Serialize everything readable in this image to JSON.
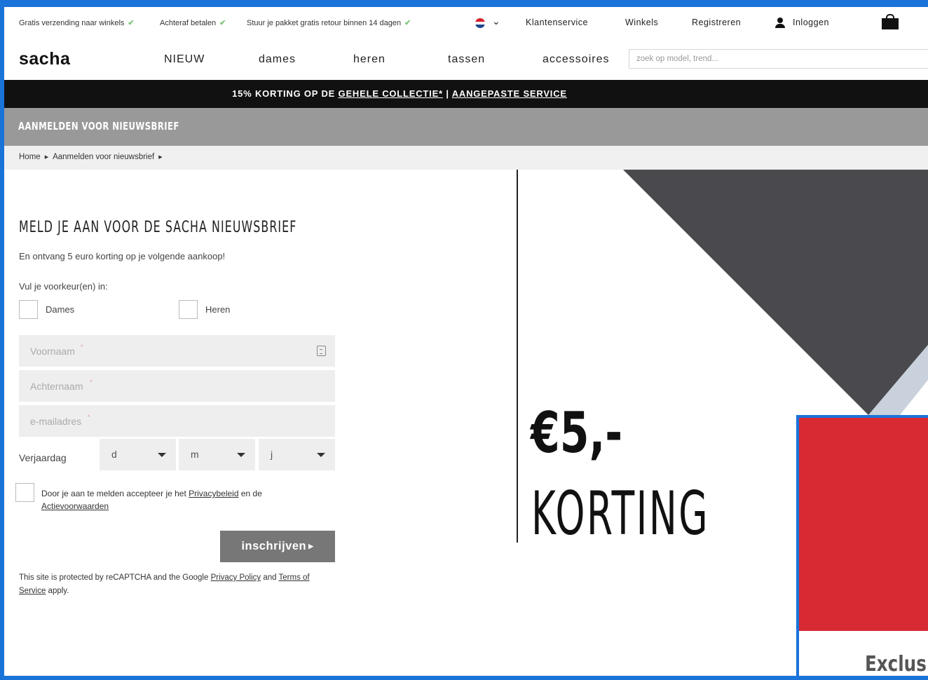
{
  "colors": {
    "frame": "#1a73d9",
    "usp_check": "#7cc576",
    "promo_bg": "#111111",
    "band_bg": "#999999",
    "breadcrumb_bg": "#f0f0f0",
    "field_bg": "#eeeeee",
    "button_bg": "#777777",
    "hero_dark": "#4a4a4e",
    "popup_red": "#d82a32"
  },
  "usp": [
    {
      "text": "Gratis verzending naar winkels",
      "icon": "check-icon"
    },
    {
      "text": "Achteraf betalen",
      "icon": "check-icon"
    },
    {
      "text": "Stuur je pakket gratis retour binnen 14 dagen",
      "icon": "check-icon"
    }
  ],
  "topnav": {
    "language_icon": "dutch-flag-icon",
    "language_chevron": "chevron-down-icon",
    "customer_service": "Klantenservice",
    "stores": "Winkels",
    "register": "Registreren",
    "login_icon": "user-icon",
    "login": "Inloggen",
    "cart_icon": "shopping-bag-icon"
  },
  "nav": {
    "logo": "sacha",
    "items": [
      "NIEUW",
      "dames",
      "heren",
      "tassen",
      "accessoires"
    ],
    "search_placeholder": "zoek op model, trend..."
  },
  "promo": {
    "prefix": "15% KORTING OP DE ",
    "link1": "GEHELE COLLECTIE*",
    "separator": " | ",
    "link2": "AANGEPASTE SERVICE"
  },
  "page_title": "AANMELDEN VOOR NIEUWSBRIEF",
  "breadcrumb": [
    "Home",
    "Aanmelden voor nieuwsbrief"
  ],
  "form": {
    "title": "MELD JE AAN VOOR DE SACHA NIEUWSBRIEF",
    "subtitle": "En ontvang 5 euro korting op je volgende aankoop!",
    "preference_label": "Vul je voorkeur(en) in:",
    "preferences": [
      "Dames",
      "Heren"
    ],
    "first_name_placeholder": "Voornaam",
    "last_name_placeholder": "Achternaam",
    "email_placeholder": "e-mailadres",
    "required_mark": "*",
    "birthday_label": "Verjaardag",
    "day": "d",
    "month": "m",
    "year": "j",
    "consent_prefix": "Door je aan te melden accepteer je het ",
    "consent_link1": "Privacybeleid",
    "consent_middle": " en de ",
    "consent_link2": "Actievoorwaarden",
    "submit": "inschrijven",
    "recaptcha_prefix": "This site is protected by reCAPTCHA and the Google ",
    "recaptcha_link1": "Privacy Policy",
    "recaptcha_middle": " and ",
    "recaptcha_link2": "Terms of Service",
    "recaptcha_suffix": " apply."
  },
  "hero": {
    "price": "€5,-",
    "label": "KORTING"
  },
  "popup": {
    "text": "Exclus"
  }
}
